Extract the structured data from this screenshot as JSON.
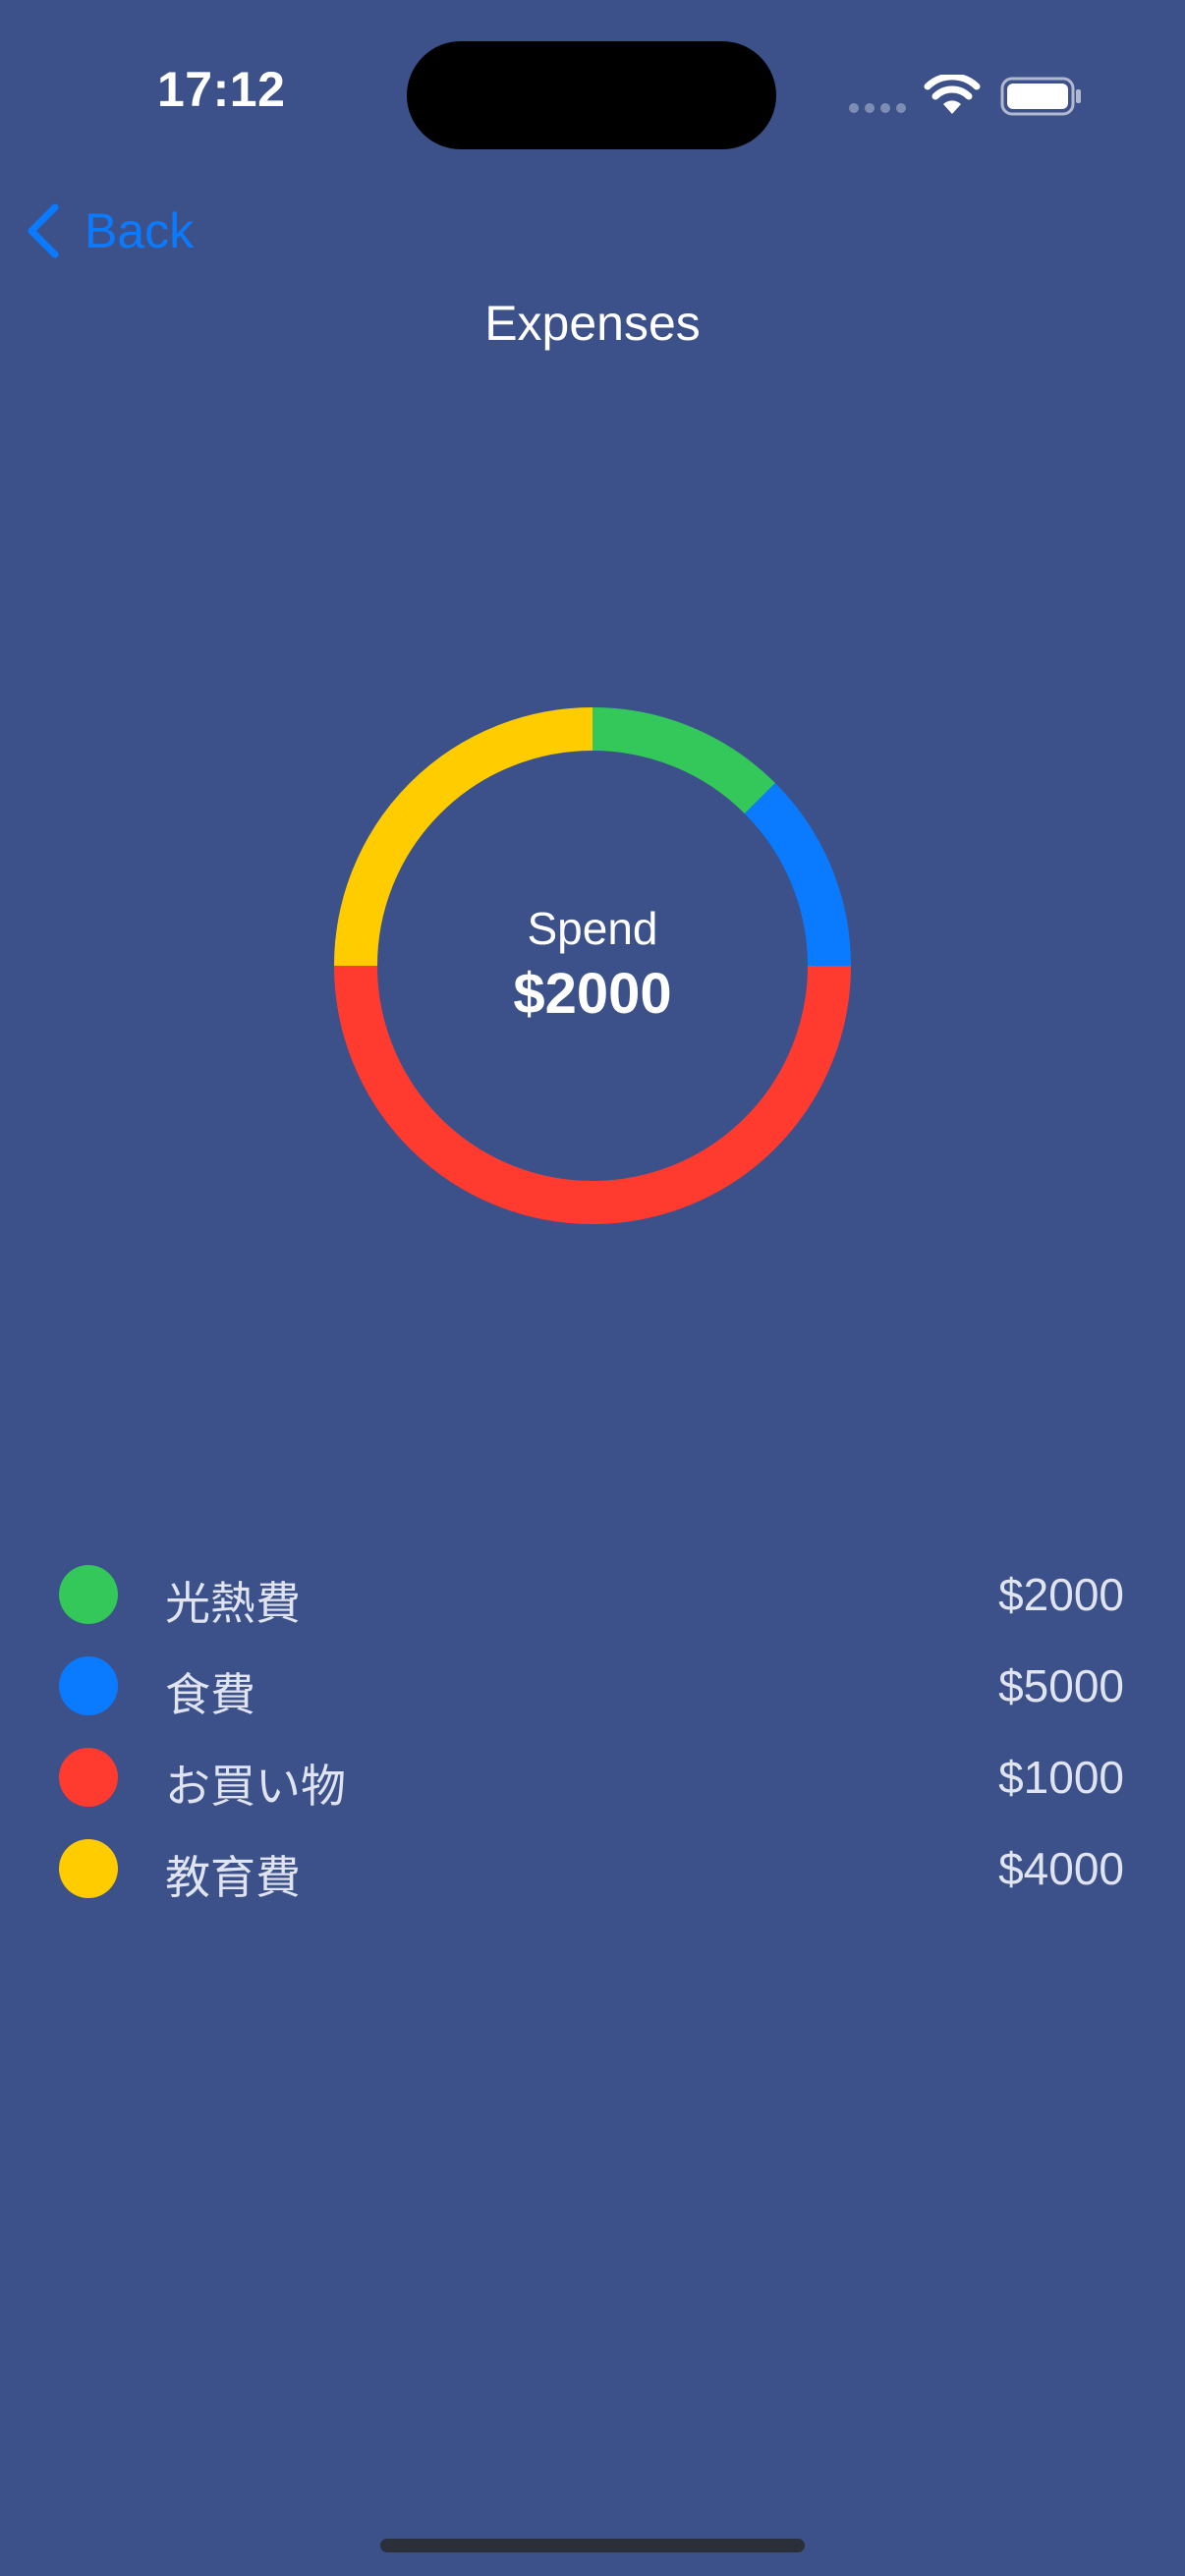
{
  "status_bar": {
    "time": "17:12",
    "icons": [
      "cellular-signal-icon",
      "wifi-icon",
      "battery-icon"
    ]
  },
  "nav": {
    "back_label": "Back",
    "back_icon": "chevron-left-icon",
    "title": "Expenses"
  },
  "summary": {
    "label": "Spend",
    "value": "$2000"
  },
  "chart_data": {
    "type": "pie",
    "donut": true,
    "start": "top",
    "direction": "clockwise",
    "slices": [
      {
        "label": "光熱費",
        "value": 12.5,
        "color": "#34c759"
      },
      {
        "label": "食費",
        "value": 12.5,
        "color": "#0a7bff"
      },
      {
        "label": "お買い物",
        "value": 50,
        "color": "#ff3b30"
      },
      {
        "label": "教育費",
        "value": 25,
        "color": "#ffcc00"
      }
    ]
  },
  "legend": [
    {
      "name": "光熱費",
      "amount": "$2000",
      "color": "#34c759"
    },
    {
      "name": "食費",
      "amount": "$5000",
      "color": "#0a7bff"
    },
    {
      "name": "お買い物",
      "amount": "$1000",
      "color": "#ff3b30"
    },
    {
      "name": "教育費",
      "amount": "$4000",
      "color": "#ffcc00"
    }
  ],
  "colors": {
    "background": "#3c5189",
    "accent": "#0a7bff"
  }
}
